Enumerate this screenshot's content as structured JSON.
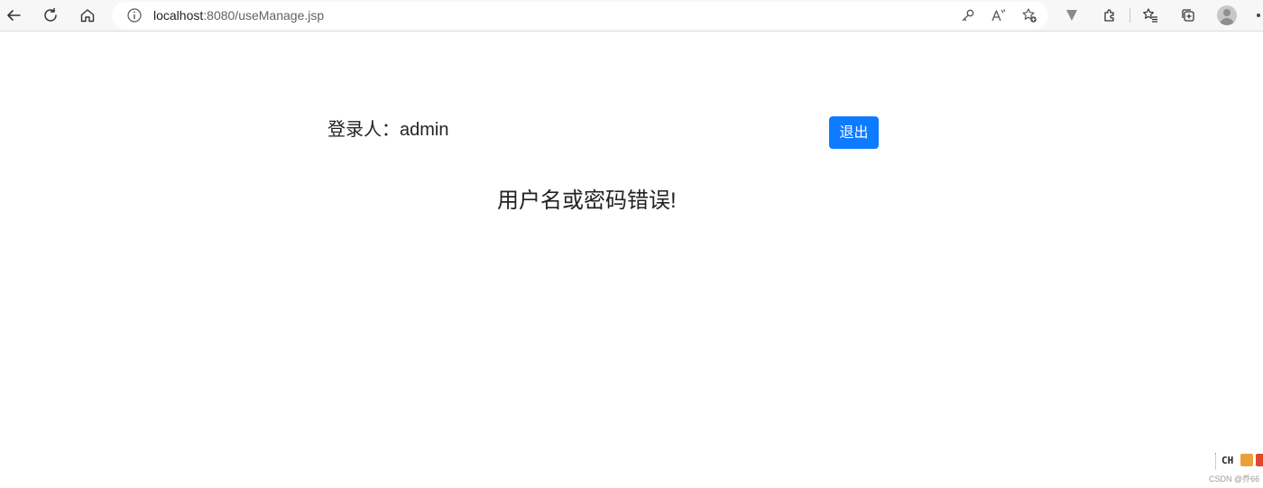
{
  "browser": {
    "url_host": "localhost",
    "url_rest": ":8080/useManage.jsp",
    "icons": [
      "back-icon",
      "refresh-icon",
      "home-icon",
      "site-info-icon",
      "key-icon",
      "read-aloud-icon",
      "add-favorite-icon",
      "extension-v-icon",
      "extensions-icon",
      "favorites-icon",
      "collections-icon",
      "profile-avatar-icon",
      "more-icon"
    ]
  },
  "page": {
    "login_label": "登录人：admin",
    "logout_label": "退出",
    "error_message": "用户名或密码错误!"
  },
  "taskbar": {
    "ime_label": "CH",
    "watermark": "CSDN @乔66"
  },
  "colors": {
    "primary_button": "#0d7bff",
    "toolbar_bg": "#f7f7f7"
  }
}
